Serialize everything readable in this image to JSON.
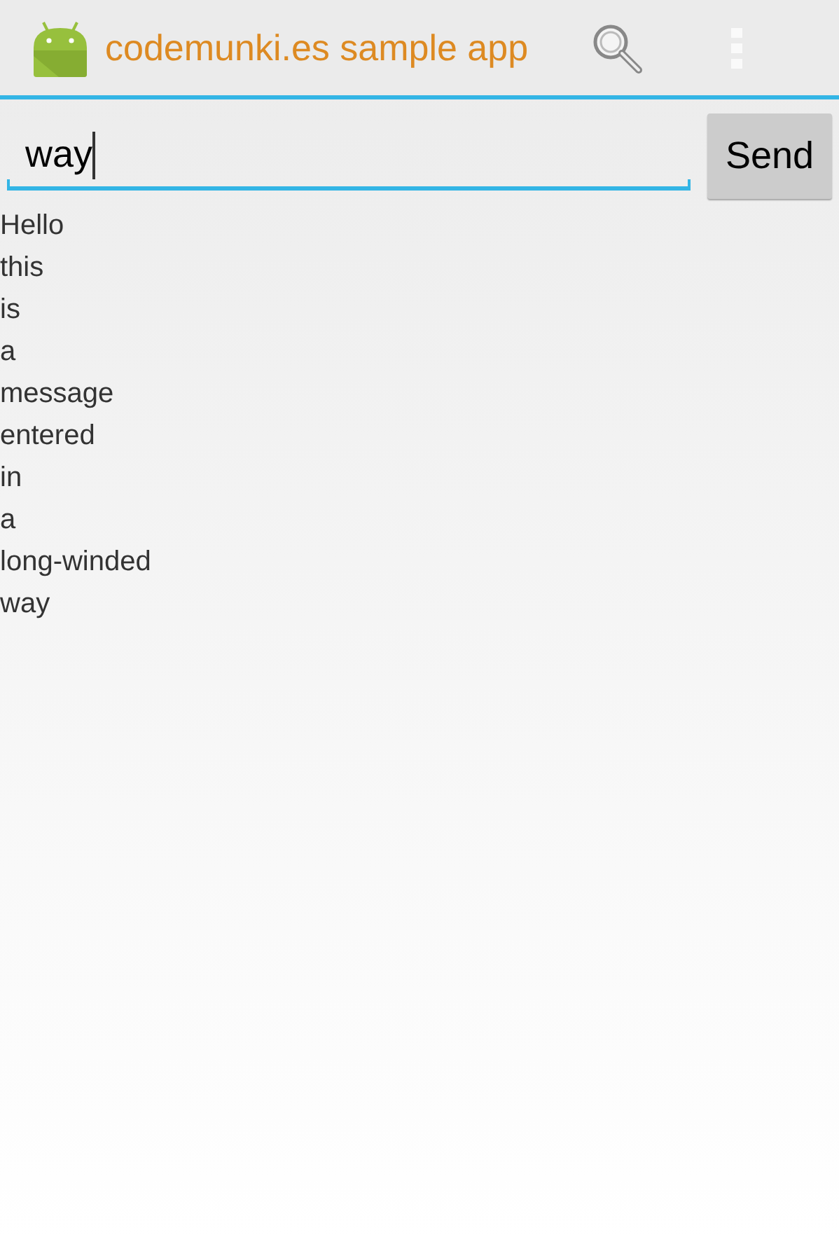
{
  "action_bar": {
    "title": "codemunki.es sample app"
  },
  "compose": {
    "value": "way",
    "focused": true,
    "send_label": "Send"
  },
  "messages": [
    "Hello",
    "this",
    "is",
    "a",
    "message",
    "entered",
    "in",
    "a",
    "long-winded",
    "way"
  ]
}
